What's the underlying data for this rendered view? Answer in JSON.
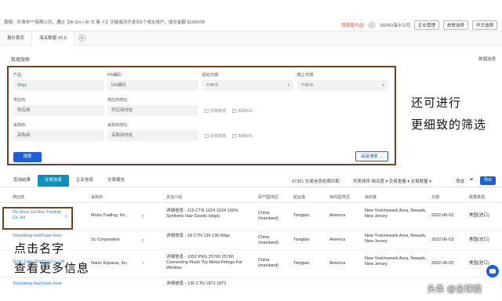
{
  "topbar": {
    "notice": "喜报：乐清市***有限公司，通过【AI Gro / AI 大 客 人】功能成功开发到1个成交用户，成交金额 $100078!",
    "hot_tag": "感谢喜大运!",
    "demo_label": "DEMO演示公司",
    "btn_company": "企业管理",
    "btn_skin": "皮肤选择",
    "btn_language": "中文选择"
  },
  "tabs": [
    {
      "label": "报价首页"
    },
    {
      "label": "海关数据 V5.0"
    }
  ],
  "search": {
    "section_title": "数据搜索",
    "section_right": "数据选择",
    "product_label": "产品:",
    "product_value": "Wigs",
    "hs_label": "HS编码:",
    "hs_placeholder": "HS编码",
    "start_label": "起始日期:",
    "start_placeholder": "Y-M-D",
    "end_label": "截止日期:",
    "end_placeholder": "Y-M-D",
    "supplier_label": "供应商:",
    "supplier_placeholder": "供应商",
    "supplier_addr_label": "供应商地址:",
    "supplier_addr_placeholder": "供应商地址",
    "buyer_label": "采购商:",
    "buyer_placeholder": "采购商",
    "buyer_addr_label": "采购商地址:",
    "buyer_addr_placeholder": "采购商地址",
    "chk_logistics": "去除物流",
    "chk_nvl": "去除NVL",
    "search_btn": "搜索",
    "advanced_btn": "高级搜索"
  },
  "annotations": {
    "filter_note_1": "还可进行",
    "filter_note_2": "更细致的筛选",
    "click_note_1": "点击名字",
    "click_note_2": "查看更多信息"
  },
  "results": {
    "tabs": [
      "查询结果",
      "交易信息",
      "企业信息",
      "交易报告"
    ],
    "active_tab": 1,
    "count_text": "57301 交易信息检索匹配",
    "sort_text": "列表排序  相关度 ▾  交易重量 ▾  交易数量 ▾",
    "filter_label": "筛选",
    "export_label": "导出"
  },
  "table": {
    "headers": [
      "供应商",
      "采购商",
      "货运介绍",
      "原产国/地区",
      "起运港",
      "目的国/地区",
      "目的港",
      "日期",
      "数据来源"
    ],
    "rows": [
      {
        "supplier": "De Zhou Jia Ran Trading Co.,ltd",
        "buyer": "Modu Trading, Inc.",
        "cargo": "详细信息 - 115 CTN 1624 1624 100% Synthetic Hair Goods (wigs)",
        "origin": "China (mainland)",
        "port_from": "Tsingtao",
        "dest": "America",
        "port_to": "New York/newark Area, Newark, New Jersey",
        "date": "2022-06-03",
        "source": "美国(进口)"
      },
      {
        "supplier": "Shandong Haichuan Keer",
        "buyer": "Sc Corporation",
        "cargo": "详细信息 - 18 CTN 136 136 Wigs",
        "origin": "China (mainland)",
        "port_from": "Tsingtao",
        "dest": "America",
        "port_to": "New York/newark Area, Newark, New Jersey",
        "date": "2022-06-03",
        "source": "美国(进口)"
      },
      {
        "supplier": "Quoc Long Trading Co.,Ltd",
        "buyer": "Nanix Express, Inc.",
        "cargo": "详细信息 - 1652 PKG 25760 25760 Connecting Plush Toy Metal Fittings For Window",
        "origin": "China (mainland)",
        "port_from": "Tsingtao",
        "dest": "America",
        "port_to": "New York/newark Area, Newark, New Jersey",
        "date": "2022-06-03",
        "source": "美国(进口)"
      },
      {
        "supplier": "Shandong Haichuan Keer",
        "buyer": "",
        "cargo": "详细信息 - 136 CTN 1872 1872",
        "origin": "",
        "port_from": "",
        "dest": "",
        "port_to": "",
        "date": "",
        "source": ""
      }
    ]
  },
  "watermark": "头条 @全球搜",
  "colors": {
    "primary": "#1d5fd6",
    "tab_active": "#0f8fbe",
    "highlight_frame": "#6b4225",
    "link": "#2a7dd1"
  }
}
